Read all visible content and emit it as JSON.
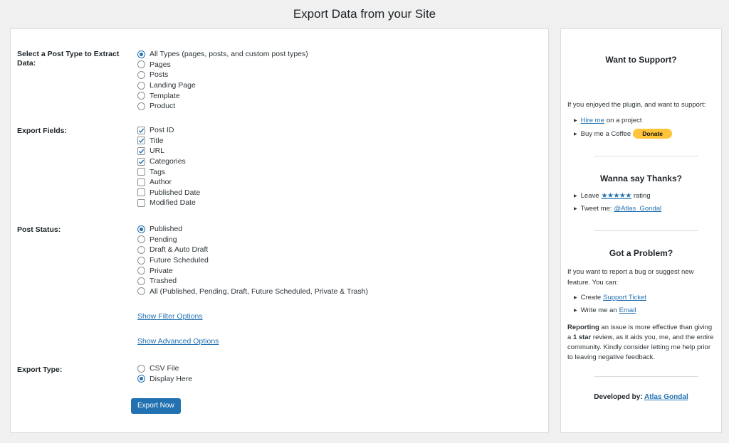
{
  "page": {
    "title": "Export Data from your Site"
  },
  "form": {
    "post_type": {
      "label": "Select a Post Type to Extract Data:",
      "options": [
        {
          "label": "All Types (pages, posts, and custom post types)",
          "checked": true
        },
        {
          "label": "Pages",
          "checked": false
        },
        {
          "label": "Posts",
          "checked": false
        },
        {
          "label": "Landing Page",
          "checked": false
        },
        {
          "label": "Template",
          "checked": false
        },
        {
          "label": "Product",
          "checked": false
        }
      ]
    },
    "export_fields": {
      "label": "Export Fields:",
      "options": [
        {
          "label": "Post ID",
          "checked": true
        },
        {
          "label": "Title",
          "checked": true
        },
        {
          "label": "URL",
          "checked": true
        },
        {
          "label": "Categories",
          "checked": true
        },
        {
          "label": "Tags",
          "checked": false
        },
        {
          "label": "Author",
          "checked": false
        },
        {
          "label": "Published Date",
          "checked": false
        },
        {
          "label": "Modified Date",
          "checked": false
        }
      ]
    },
    "post_status": {
      "label": "Post Status:",
      "options": [
        {
          "label": "Published",
          "checked": true
        },
        {
          "label": "Pending",
          "checked": false
        },
        {
          "label": "Draft & Auto Draft",
          "checked": false
        },
        {
          "label": "Future Scheduled",
          "checked": false
        },
        {
          "label": "Private",
          "checked": false
        },
        {
          "label": "Trashed",
          "checked": false
        },
        {
          "label": "All (Published, Pending, Draft, Future Scheduled, Private & Trash)",
          "checked": false
        }
      ]
    },
    "show_filter_link": "Show Filter Options",
    "show_advanced_link": "Show Advanced Options",
    "export_type": {
      "label": "Export Type:",
      "options": [
        {
          "label": "CSV File",
          "checked": false
        },
        {
          "label": "Display Here",
          "checked": true
        }
      ]
    },
    "submit_label": "Export Now"
  },
  "sidebar": {
    "support": {
      "heading": "Want to Support?",
      "intro": "If you enjoyed the plugin, and want to support:",
      "hire_link": "Hire me",
      "hire_suffix": "on a project",
      "coffee_text": "Buy me a Coffee",
      "donate_label": "Donate"
    },
    "thanks": {
      "heading": "Wanna say Thanks?",
      "leave_prefix": "Leave",
      "stars": "★★★★★",
      "rating_suffix": "rating",
      "tweet_prefix": "Tweet me:",
      "tweet_link": "@Atlas_Gondal"
    },
    "problem": {
      "heading": "Got a Problem?",
      "intro": "If you want to report a bug or suggest new feature. You can:",
      "ticket_prefix": "Create",
      "ticket_link": "Support Ticket",
      "email_prefix": "Write me an",
      "email_link": "Email",
      "note_bold1": "Reporting",
      "note_part1": " an issue is more effective than giving a ",
      "note_bold2": "1 star",
      "note_part2": " review, as it aids you, me, and the entire community. Kindly consider letting me help prior to leaving negative feedback."
    },
    "footer": {
      "prefix": "Developed by:",
      "author_link": "Atlas Gondal"
    }
  },
  "colors": {
    "accent": "#2271b1",
    "donate": "#ffc439",
    "background": "#f0f0f1"
  }
}
